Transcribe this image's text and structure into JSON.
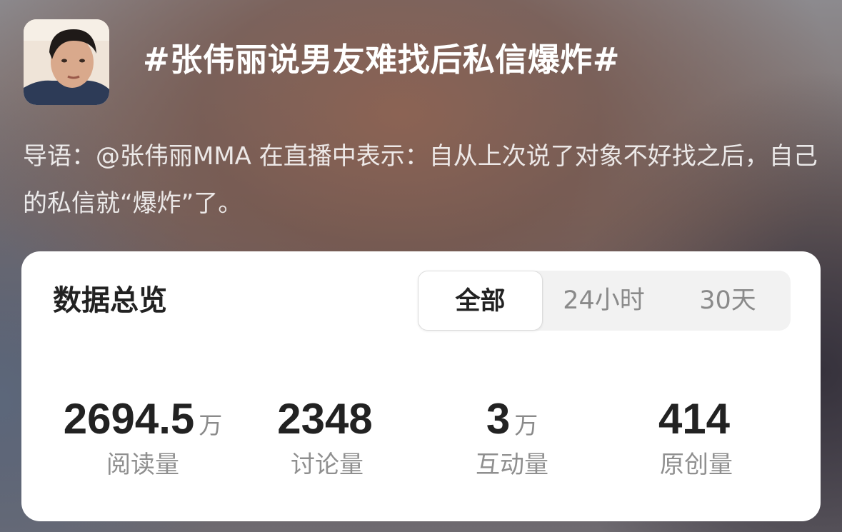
{
  "header": {
    "title": "#张伟丽说男友难找后私信爆炸#",
    "avatar_icon": "user-avatar"
  },
  "intro": {
    "text": "导语：@张伟丽MMA 在直播中表示：自从上次说了对象不好找之后，自己的私信就“爆炸”了。"
  },
  "overview": {
    "title": "数据总览",
    "tabs": [
      {
        "label": "全部",
        "active": true
      },
      {
        "label": "24小时",
        "active": false
      },
      {
        "label": "30天",
        "active": false
      }
    ],
    "stats": [
      {
        "value": "2694.5",
        "unit": "万",
        "label": "阅读量"
      },
      {
        "value": "2348",
        "unit": "",
        "label": "讨论量"
      },
      {
        "value": "3",
        "unit": "万",
        "label": "互动量"
      },
      {
        "value": "414",
        "unit": "",
        "label": "原创量"
      }
    ]
  },
  "colors": {
    "card_bg": "#ffffff",
    "text_primary": "#222222",
    "text_secondary": "#8a8a8a",
    "segment_bg": "#f2f2f2"
  }
}
